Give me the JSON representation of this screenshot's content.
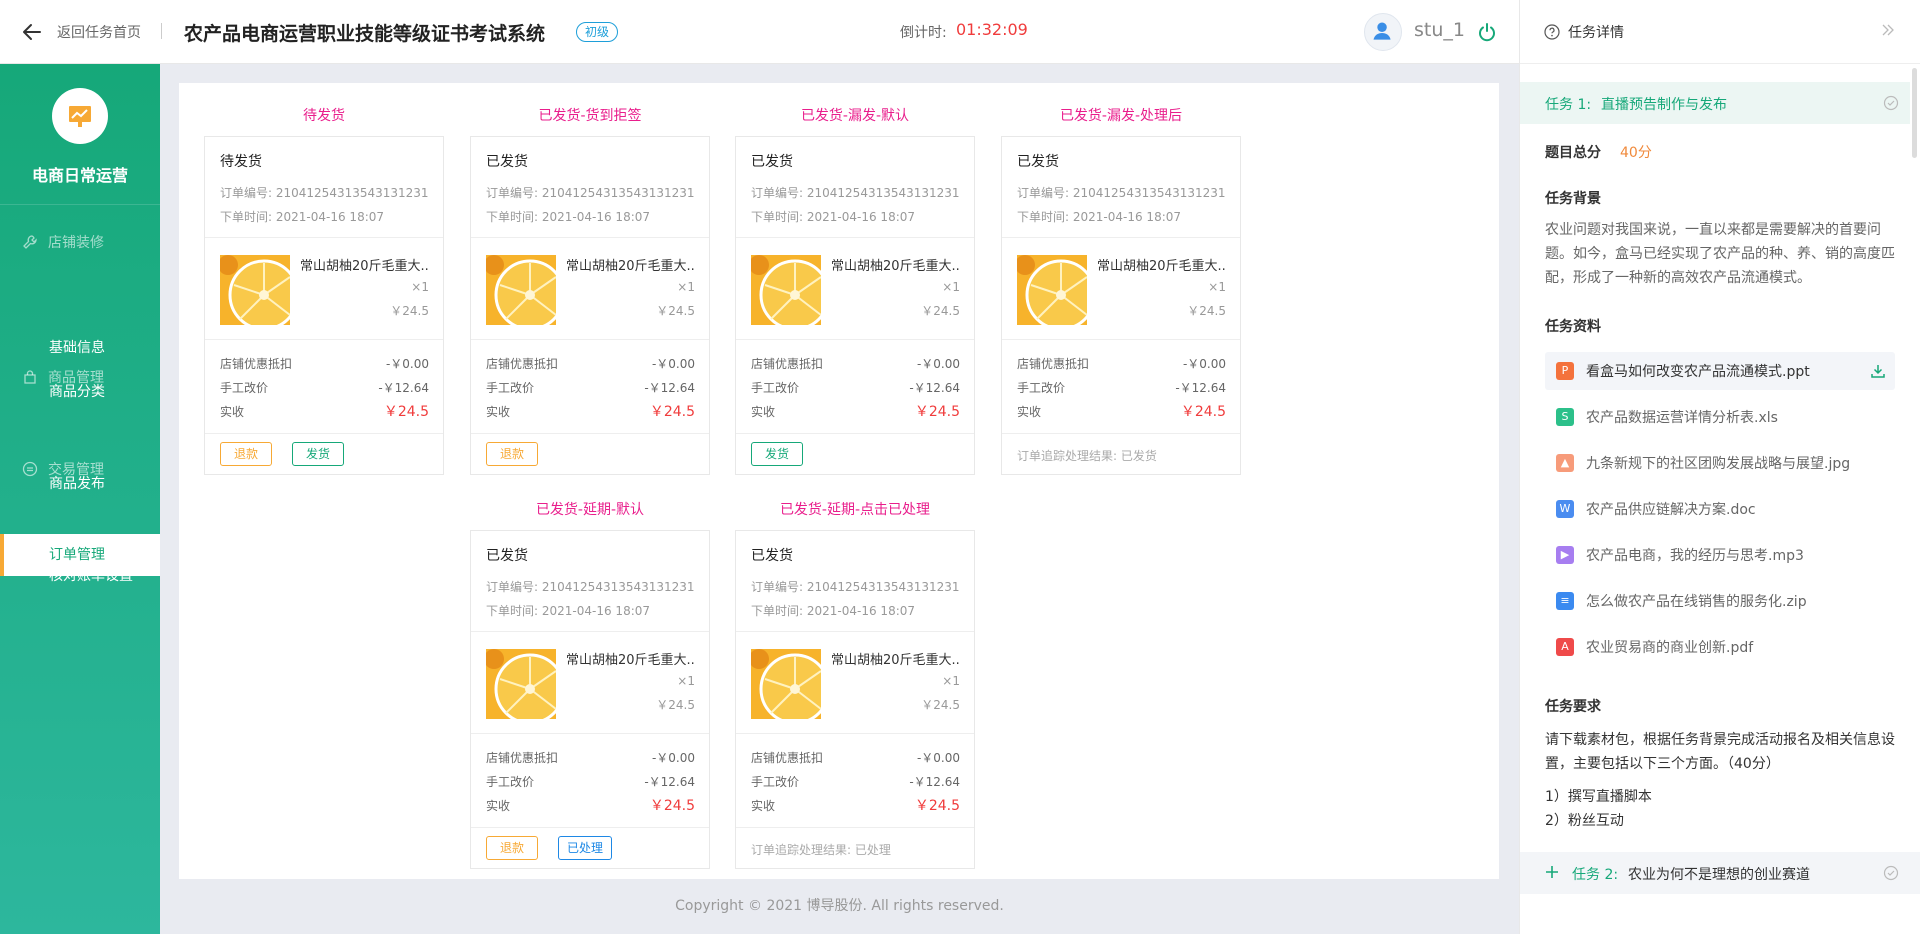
{
  "header": {
    "back_label": "返回任务首页",
    "system_title": "农产品电商运营职业技能等级证书考试系统",
    "level_badge": "初级",
    "countdown_label": "倒计时:",
    "countdown_value": "01:32:09",
    "username": "stu_1"
  },
  "sidebar": {
    "brand": "电商日常运营",
    "groups": [
      {
        "label": "店铺装修",
        "icon": "wrench-icon",
        "items": [
          {
            "label": "基础信息"
          },
          {
            "label": "商品分类"
          }
        ]
      },
      {
        "label": "商品管理",
        "icon": "bag-icon",
        "items": [
          {
            "label": "商品发布"
          }
        ]
      },
      {
        "label": "交易管理",
        "icon": "transaction-icon",
        "items": [
          {
            "label": "核对账单设置"
          },
          {
            "label": "订单管理",
            "active": true
          }
        ]
      }
    ]
  },
  "orders": {
    "labels": {
      "order_no": "订单编号:",
      "order_time": "下单时间:",
      "discount": "店铺优惠抵扣",
      "manual": "手工改价",
      "actual": "实收",
      "trace": "订单追踪处理结果:",
      "refund": "退款",
      "ship": "发货",
      "processed": "已处理"
    },
    "cards": [
      {
        "title": "待发货",
        "status": "待发货",
        "order_no": "21041254313543131231",
        "order_time": "2021-04-16  18:07",
        "product": "常山胡柚20斤毛重大...",
        "qty": "×1",
        "price": "￥24.5",
        "discount": "-￥0.00",
        "manual": "-￥12.64",
        "actual": "￥24.5",
        "buttons": [
          "refund",
          "ship"
        ]
      },
      {
        "title": "已发货-货到拒签",
        "status": "已发货",
        "order_no": "21041254313543131231",
        "order_time": "2021-04-16  18:07",
        "product": "常山胡柚20斤毛重大...",
        "qty": "×1",
        "price": "￥24.5",
        "discount": "-￥0.00",
        "manual": "-￥12.64",
        "actual": "￥24.5",
        "buttons": [
          "refund"
        ]
      },
      {
        "title": "已发货-漏发-默认",
        "status": "已发货",
        "order_no": "21041254313543131231",
        "order_time": "2021-04-16  18:07",
        "product": "常山胡柚20斤毛重大...",
        "qty": "×1",
        "price": "￥24.5",
        "discount": "-￥0.00",
        "manual": "-￥12.64",
        "actual": "￥24.5",
        "buttons": [
          "ship"
        ]
      },
      {
        "title": "已发货-漏发-处理后",
        "status": "已发货",
        "order_no": "21041254313543131231",
        "order_time": "2021-04-16  18:07",
        "product": "常山胡柚20斤毛重大...",
        "qty": "×1",
        "price": "￥24.5",
        "discount": "-￥0.00",
        "manual": "-￥12.64",
        "actual": "￥24.5",
        "trace_result": "已发货"
      },
      {
        "title": "已发货-延期-默认",
        "status": "已发货",
        "order_no": "21041254313543131231",
        "order_time": "2021-04-16  18:07",
        "product": "常山胡柚20斤毛重大...",
        "qty": "×1",
        "price": "￥24.5",
        "discount": "-￥0.00",
        "manual": "-￥12.64",
        "actual": "￥24.5",
        "buttons": [
          "refund",
          "processed"
        ]
      },
      {
        "title": "已发货-延期-点击已处理",
        "status": "已发货",
        "order_no": "21041254313543131231",
        "order_time": "2021-04-16  18:07",
        "product": "常山胡柚20斤毛重大...",
        "qty": "×1",
        "price": "￥24.5",
        "discount": "-￥0.00",
        "manual": "-￥12.64",
        "actual": "￥24.5",
        "trace_result": "已处理"
      }
    ]
  },
  "footer": "Copyright © 2021 博导股份. All rights reserved.",
  "panel": {
    "title": "任务详情",
    "task1": {
      "label": "任务 1:",
      "title": "直播预告制作与发布"
    },
    "score_label": "题目总分",
    "score_value": "40分",
    "background_label": "任务背景",
    "background_text": "农业问题对我国来说，一直以来都是需要解决的首要问题。如今，盒马已经实现了农产品的种、养、销的高度匹配，形成了一种新的高效农产品流通模式。",
    "materials_label": "任务资料",
    "materials": [
      {
        "name": "看盒马如何改变农产品流通模式.ppt",
        "icon": "ppt-icon",
        "color": "#f4723c",
        "glyph": "P"
      },
      {
        "name": "农产品数据运营详情分析表.xls",
        "icon": "xls-icon",
        "color": "#2cc08a",
        "glyph": "S"
      },
      {
        "name": "九条新规下的社区团购发展战略与展望.jpg",
        "icon": "jpg-icon",
        "color": "#f79b7a",
        "glyph": "▲"
      },
      {
        "name": "农产品供应链解决方案.doc",
        "icon": "doc-icon",
        "color": "#4a8cf0",
        "glyph": "W"
      },
      {
        "name": "农产品电商，我的经历与思考.mp3",
        "icon": "mp3-icon",
        "color": "#a77ef0",
        "glyph": "▶"
      },
      {
        "name": "怎么做农产品在线销售的服务化.zip",
        "icon": "zip-icon",
        "color": "#3b8af0",
        "glyph": "≡"
      },
      {
        "name": "农业贸易商的商业创新.pdf",
        "icon": "pdf-icon",
        "color": "#ef4a4a",
        "glyph": "A"
      }
    ],
    "requirements_label": "任务要求",
    "requirements_text": "请下载素材包，根据任务背景完成活动报名及相关信息设置，主要包括以下三个方面。（40分）",
    "requirement_items": [
      "1）撰写直播脚本",
      "2）粉丝互动"
    ],
    "task2": {
      "label": "任务 2:",
      "title": "农业为何不是理想的创业赛道"
    }
  }
}
